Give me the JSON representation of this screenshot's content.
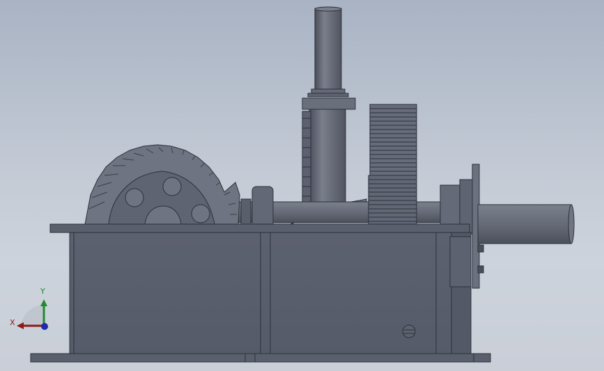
{
  "triad": {
    "x_label": "X",
    "y_label": "Y",
    "colors": {
      "x": "#8b1a1a",
      "y": "#1f8a2e",
      "z": "#1f2aa8"
    }
  },
  "colors": {
    "housing": "#5a5f6c",
    "housing_dark": "#3f434d",
    "gear": "#6a6f7c",
    "shaft": "#676c79",
    "background_top": "#a9b3c4",
    "background_bottom": "#c9ced7"
  },
  "icons": [
    "bevel-gear-icon",
    "spur-gear-icon",
    "worm-gear-icon",
    "vertical-shaft-icon",
    "output-shaft-icon",
    "gearbox-housing-icon",
    "coordinate-triad-icon"
  ]
}
